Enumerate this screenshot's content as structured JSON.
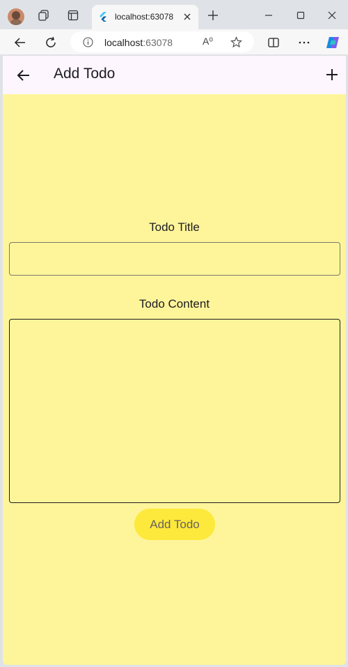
{
  "browser": {
    "tab_title": "localhost:63078",
    "url_host": "localhost",
    "url_port": ":63078",
    "read_aloud_glyph": "A⁰"
  },
  "appbar": {
    "title": "Add Todo"
  },
  "form": {
    "title_label": "Todo Title",
    "title_value": "",
    "content_label": "Todo Content",
    "content_value": "",
    "submit_label": "Add Todo"
  },
  "colors": {
    "app_background": "#fef59b",
    "appbar_background": "#fdf6ff",
    "button_background": "#fde93b",
    "button_text": "#6a6160"
  },
  "icons": [
    "profile-avatar-icon",
    "workspaces-icon",
    "tab-actions-icon",
    "flutter-icon",
    "close-icon",
    "new-tab-icon",
    "minimize-icon",
    "maximize-icon",
    "close-window-icon",
    "back-icon",
    "refresh-icon",
    "info-icon",
    "read-aloud-icon",
    "favorite-icon",
    "split-screen-icon",
    "more-icon",
    "copilot-icon",
    "arrow-back-icon",
    "add-icon"
  ]
}
